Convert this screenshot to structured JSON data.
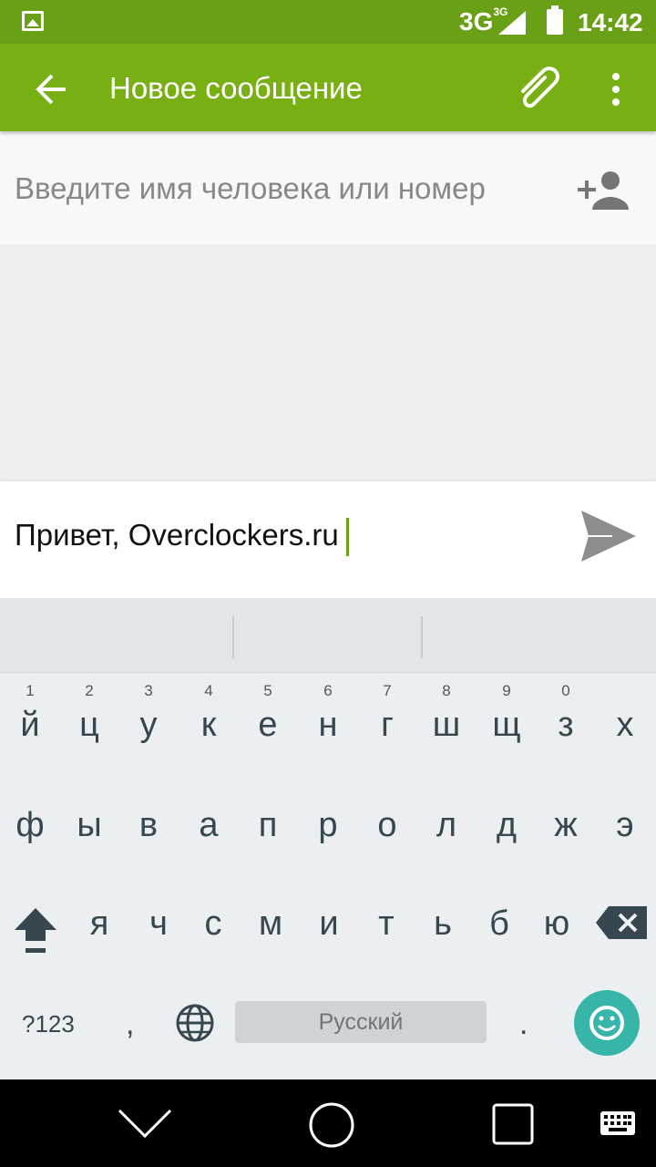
{
  "status_bar": {
    "network": "3G",
    "network_small": "3G",
    "time": "14:42"
  },
  "app_bar": {
    "title": "Новое сообщение",
    "back_icon": "arrow-back-icon",
    "attach_icon": "paperclip-icon",
    "menu_icon": "more-vert-icon"
  },
  "recipient": {
    "placeholder": "Введите имя человека или номер",
    "add_icon": "add-person-icon"
  },
  "compose": {
    "text": "Привет, Overclockers.ru",
    "send_icon": "send-icon"
  },
  "keyboard": {
    "row1": [
      {
        "ch": "й",
        "num": "1"
      },
      {
        "ch": "ц",
        "num": "2"
      },
      {
        "ch": "у",
        "num": "3"
      },
      {
        "ch": "к",
        "num": "4"
      },
      {
        "ch": "е",
        "num": "5"
      },
      {
        "ch": "н",
        "num": "6"
      },
      {
        "ch": "г",
        "num": "7"
      },
      {
        "ch": "ш",
        "num": "8"
      },
      {
        "ch": "щ",
        "num": "9"
      },
      {
        "ch": "з",
        "num": "0"
      },
      {
        "ch": "х",
        "num": ""
      }
    ],
    "row2": [
      "ф",
      "ы",
      "в",
      "а",
      "п",
      "р",
      "о",
      "л",
      "д",
      "ж",
      "э"
    ],
    "row3": [
      "я",
      "ч",
      "с",
      "м",
      "и",
      "т",
      "ь",
      "б",
      "ю"
    ],
    "symbols_label": "?123",
    "comma": ",",
    "space_label": "Русский",
    "period": "."
  },
  "colors": {
    "accent": "#78b014",
    "status": "#6aa015",
    "emoji_button": "#37b5a9"
  }
}
